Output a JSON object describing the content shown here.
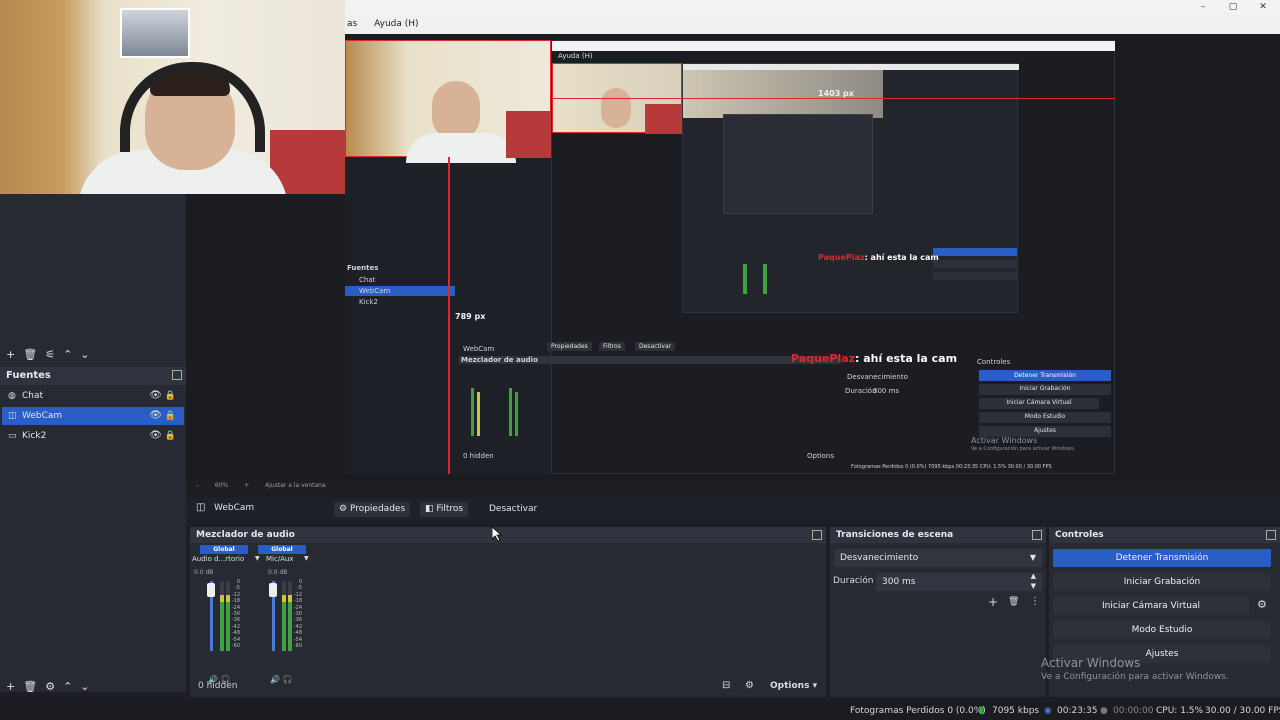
{
  "menubar": {
    "item_partial": "as",
    "help_menu": "Ayuda (H)"
  },
  "window_controls": {
    "minimize": "–",
    "restore": "▢",
    "close": "✕"
  },
  "preview": {
    "nested_window_title": "Ayuda (H)",
    "width_label": "1403 px",
    "height_label": "789 px",
    "chat_user": "PaquePlaz",
    "chat_message": ": ahí esta la cam",
    "nested_controls_header": "Controles",
    "nested_mixer_header": "Mezclador de audio",
    "nested_stop_stream": "Detener Transmisión",
    "nested_start_recording": "Iniciar Grabación",
    "nested_start_virtual_cam": "Iniciar Cámara Virtual",
    "nested_studio_mode": "Modo Estudio",
    "nested_settings": "Ajustes",
    "nested_transition": "Desvanecimiento",
    "nested_duration": "Duración",
    "nested_duration_value": "300 ms",
    "nested_webcam": "WebCam",
    "nested_props": "Propiedades",
    "nested_filters": "Filtros",
    "nested_deactivate": "Desactivar",
    "nested_hidden": "0 hidden",
    "nested_options": "Options",
    "nested_sources": "Fuentes",
    "nested_chat": "Chat",
    "nested_kick": "Kick2",
    "nested_status": "Fotogramas Perdidos 0 (0.0%)   7095 kbps   00:23:35   CPU: 1.5%   30.00 / 30.00 FPS",
    "nested_activate_title": "Activar Windows",
    "nested_activate_sub": "Ve a Configuración para activar Windows."
  },
  "zoombar": {
    "minus": "–",
    "zoom": "60%",
    "plus": "+",
    "fit": "Ajustar a la ventana"
  },
  "sources": {
    "title": "Fuentes",
    "items": [
      {
        "name": "Chat",
        "selected": false,
        "type_icon": "globe-icon"
      },
      {
        "name": "WebCam",
        "selected": true,
        "type_icon": "camera-icon"
      },
      {
        "name": "Kick2",
        "selected": false,
        "type_icon": "window-icon"
      }
    ]
  },
  "toolbar_icons": {
    "add": "+",
    "remove": "🗑",
    "filter": "⚟",
    "up": "⌃",
    "down": "⌄",
    "settings": "⚙"
  },
  "source_toolbar": {
    "source_name": "WebCam",
    "properties": "Propiedades",
    "filters": "Filtros",
    "deactivate": "Desactivar"
  },
  "mixer": {
    "title": "Mezclador de audio",
    "channels": [
      {
        "badge": "Global",
        "name": "Audio d...rtorio",
        "db": "0.0 dB"
      },
      {
        "badge": "Global",
        "name": "Mic/Aux",
        "db": "0.0 dB"
      }
    ],
    "scale": [
      "0",
      "-5",
      "-12",
      "-18",
      "-24",
      "-30",
      "-36",
      "-42",
      "-48",
      "-54",
      "-60"
    ],
    "hidden": "0 hidden",
    "options": "Options"
  },
  "transitions": {
    "title": "Transiciones de escena",
    "selected": "Desvanecimiento",
    "duration_label": "Duración",
    "duration_value": "300 ms"
  },
  "controls": {
    "title": "Controles",
    "stop_stream": "Detener Transmisión",
    "start_recording": "Iniciar Grabación",
    "start_virtual_cam": "Iniciar Cámara Virtual",
    "studio_mode": "Modo Estudio",
    "settings": "Ajustes"
  },
  "status": {
    "dropped_frames": "Fotogramas Perdidos 0 (0.0%)",
    "bitrate": "7095 kbps",
    "stream_time": "00:23:35",
    "record_time": "00:00:00",
    "cpu": "CPU: 1.5%",
    "fps": "30.00 / 30.00 FPS"
  },
  "watermark": {
    "title": "Activar Windows",
    "subtitle": "Ve a Configuración para activar Windows."
  },
  "colors": {
    "accent": "#2a5ec7",
    "record_red": "#e0272e",
    "meter_green": "#3fa13f"
  }
}
